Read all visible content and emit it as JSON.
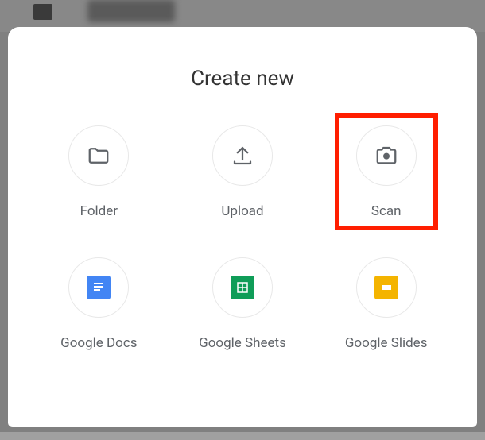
{
  "title": "Create new",
  "highlighted_option": "scan",
  "options": {
    "folder": {
      "label": "Folder"
    },
    "upload": {
      "label": "Upload"
    },
    "scan": {
      "label": "Scan"
    },
    "docs": {
      "label": "Google Docs"
    },
    "sheets": {
      "label": "Google Sheets"
    },
    "slides": {
      "label": "Google Slides"
    }
  },
  "colors": {
    "docs": "#4285f4",
    "sheets": "#0f9d58",
    "slides": "#f4b400",
    "highlight": "#ff1e00",
    "icon_gray": "#5f6368"
  }
}
